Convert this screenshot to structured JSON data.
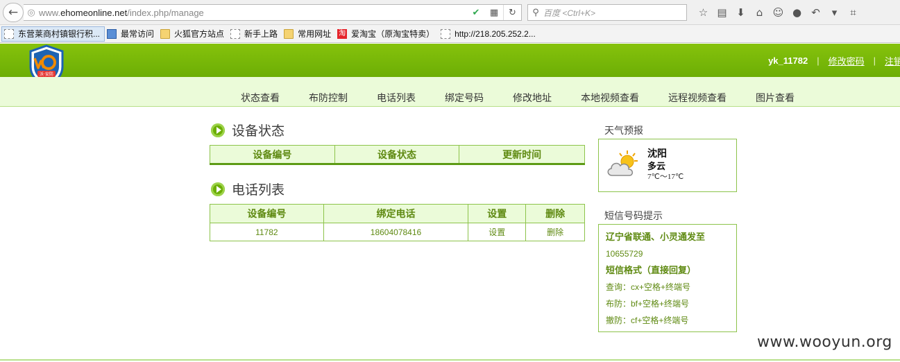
{
  "browser": {
    "url_prefix": "www.",
    "url_host": "ehomeonline.net",
    "url_path": "/index.php/manage",
    "search_placeholder": "百度 <Ctrl+K>",
    "bookmarks": [
      "东营莱商村镇银行积...",
      "最常访问",
      "火狐官方站点",
      "新手上路",
      "常用网址",
      "爱淘宝（原淘宝特卖）",
      "http://218.205.252.2..."
    ],
    "taobao_icon": "淘"
  },
  "header": {
    "logo_text": "沃·安防",
    "username": "yk_11782",
    "change_password": "修改密码",
    "logout": "注销",
    "separator": "|"
  },
  "nav": [
    "状态查看",
    "布防控制",
    "电话列表",
    "绑定号码",
    "修改地址",
    "本地视频查看",
    "远程视频查看",
    "图片查看"
  ],
  "device_status": {
    "title": "设备状态",
    "columns": [
      "设备编号",
      "设备状态",
      "更新时间"
    ]
  },
  "phone_list": {
    "title": "电话列表",
    "columns": [
      "设备编号",
      "绑定电话",
      "设置",
      "删除"
    ],
    "rows": [
      {
        "device_id": "11782",
        "phone": "18604078416",
        "set": "设置",
        "delete": "删除"
      }
    ]
  },
  "weather": {
    "title": "天气预报",
    "city": "沈阳",
    "condition": "多云",
    "temperature": "7℃～17℃"
  },
  "sms": {
    "title": "短信号码提示",
    "line1": "辽宁省联通、小灵通发至",
    "number": "10655729",
    "format_title": "短信格式（直接回复）",
    "query": "查询：cx+空格+终端号",
    "arm": "布防：bf+空格+终端号",
    "disarm": "撤防：cf+空格+终端号"
  },
  "watermark": "www.wooyun.org",
  "colors": {
    "brand_green": "#6cae05",
    "nav_bg": "#ebfbd9",
    "text_green": "#5f8a12"
  }
}
